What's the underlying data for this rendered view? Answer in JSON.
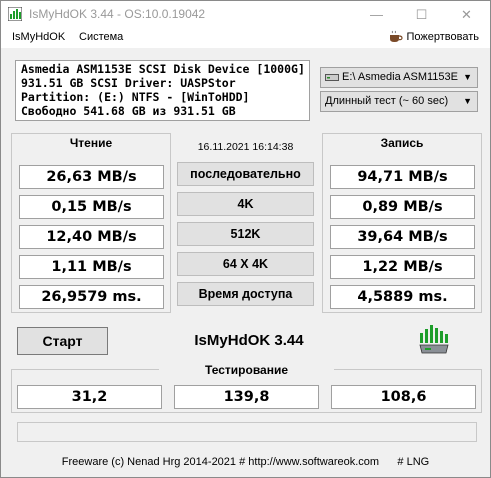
{
  "window": {
    "title": "IsMyHdOK 3.44 - OS:10.0.19042",
    "minimize_glyph": "—",
    "maximize_glyph": "☐",
    "close_glyph": "✕"
  },
  "menu": {
    "items": [
      "IsMyHdOK",
      "Система"
    ],
    "donate_label": "Пожертвовать",
    "donate_icon": "coffee-cup-icon"
  },
  "drive_info": {
    "lines": [
      "Asmedia ASM1153E SCSI Disk Device [1000G]",
      "931.51 GB  SCSI Driver: UASPStor",
      "Partition: (E:) NTFS - [WinToHDD]",
      "Свободно 541.68 GB из 931.51 GB"
    ]
  },
  "drive_select": {
    "value": "E:\\ Asmedia ASM1153E"
  },
  "test_select": {
    "value": "Длинный тест (~ 60 sec)"
  },
  "read": {
    "title": "Чтение",
    "values": [
      "26,63 MB/s",
      "0,15 MB/s",
      "12,40 MB/s",
      "1,11 MB/s",
      "26,9579 ms."
    ]
  },
  "write": {
    "title": "Запись",
    "values": [
      "94,71 MB/s",
      "0,89 MB/s",
      "39,64 MB/s",
      "1,22 MB/s",
      "4,5889 ms."
    ]
  },
  "center": {
    "datetime": "16.11.2021 16:14:38",
    "modes": [
      "последовательно",
      "4K",
      "512K",
      "64 X 4K",
      "Время доступа"
    ]
  },
  "actions": {
    "start_label": "Старт",
    "app_name": "IsMyHdOK 3.44"
  },
  "testing": {
    "title": "Тестирование",
    "values": [
      "31,2",
      "139,8",
      "108,6"
    ]
  },
  "footer": {
    "text": "Freeware (c) Nenad Hrg 2014-2021 # http://www.softwareok.com      # LNG"
  },
  "colors": {
    "icon_green": "#1d9d2a",
    "panel_border": "#c8c8c8"
  }
}
